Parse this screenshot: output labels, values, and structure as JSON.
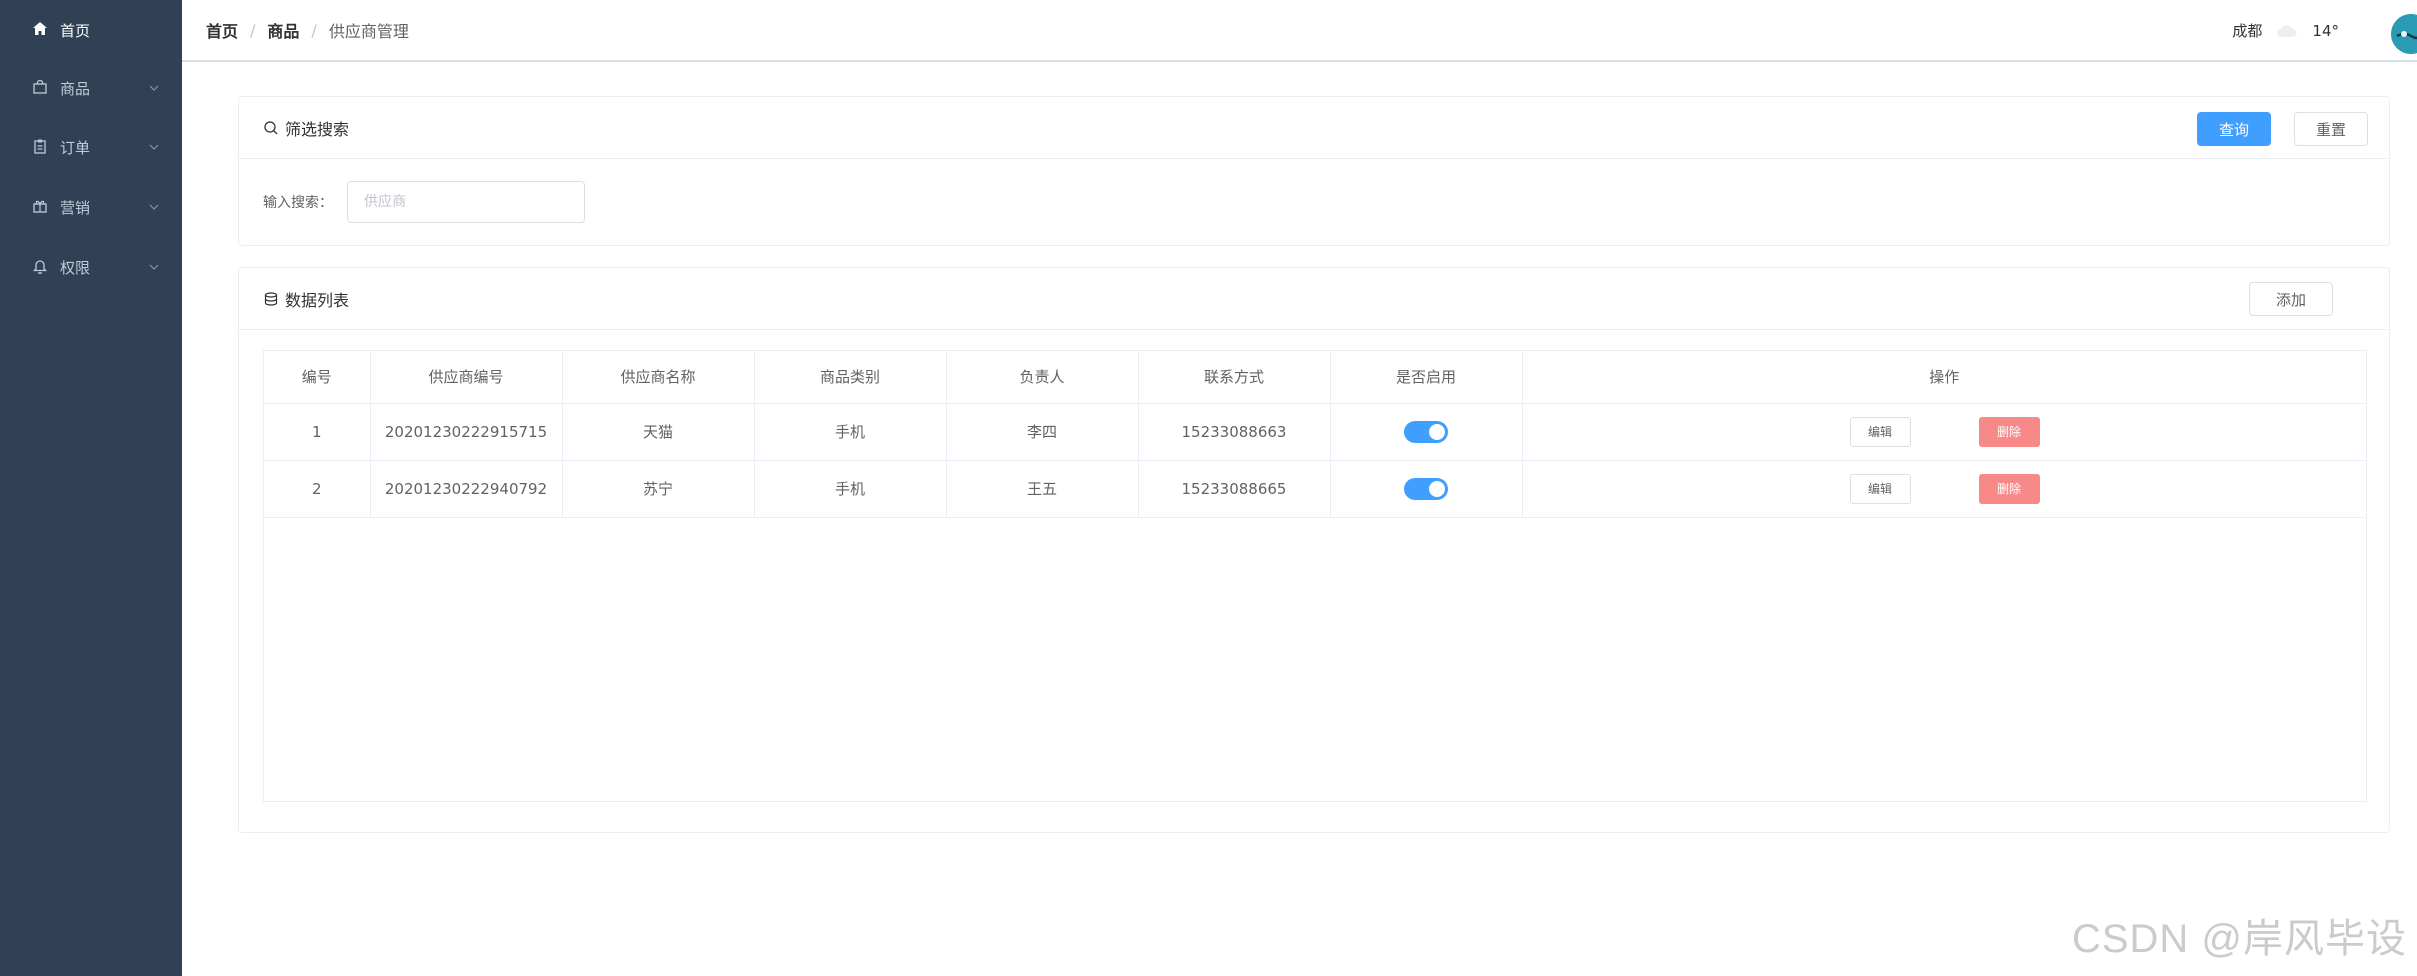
{
  "sidebar": {
    "items": [
      {
        "label": "首页",
        "icon": "home-icon"
      },
      {
        "label": "商品",
        "icon": "bag-icon"
      },
      {
        "label": "订单",
        "icon": "clipboard-icon"
      },
      {
        "label": "营销",
        "icon": "gift-icon"
      },
      {
        "label": "权限",
        "icon": "bell-icon"
      }
    ]
  },
  "header": {
    "breadcrumb": [
      "首页",
      "商品",
      "供应商管理"
    ],
    "separator": "/",
    "city": "成都",
    "temperature": "14°"
  },
  "filter": {
    "title": "筛选搜索",
    "query_label": "查询",
    "reset_label": "重置",
    "search_label": "输入搜索：",
    "search_placeholder": "供应商",
    "search_value": ""
  },
  "list": {
    "title": "数据列表",
    "add_label": "添加",
    "columns": [
      "编号",
      "供应商编号",
      "供应商名称",
      "商品类别",
      "负责人",
      "联系方式",
      "是否启用",
      "操作"
    ],
    "rows": [
      {
        "id": "1",
        "code": "20201230222915715",
        "name": "天猫",
        "category": "手机",
        "owner": "李四",
        "phone": "15233088663",
        "enabled": true
      },
      {
        "id": "2",
        "code": "20201230222940792",
        "name": "苏宁",
        "category": "手机",
        "owner": "王五",
        "phone": "15233088665",
        "enabled": true
      }
    ],
    "edit_label": "编辑",
    "delete_label": "删除"
  },
  "watermark": "CSDN @岸风毕设",
  "colors": {
    "sidebar_bg": "#304156",
    "primary": "#409eff",
    "danger": "#f78989"
  }
}
